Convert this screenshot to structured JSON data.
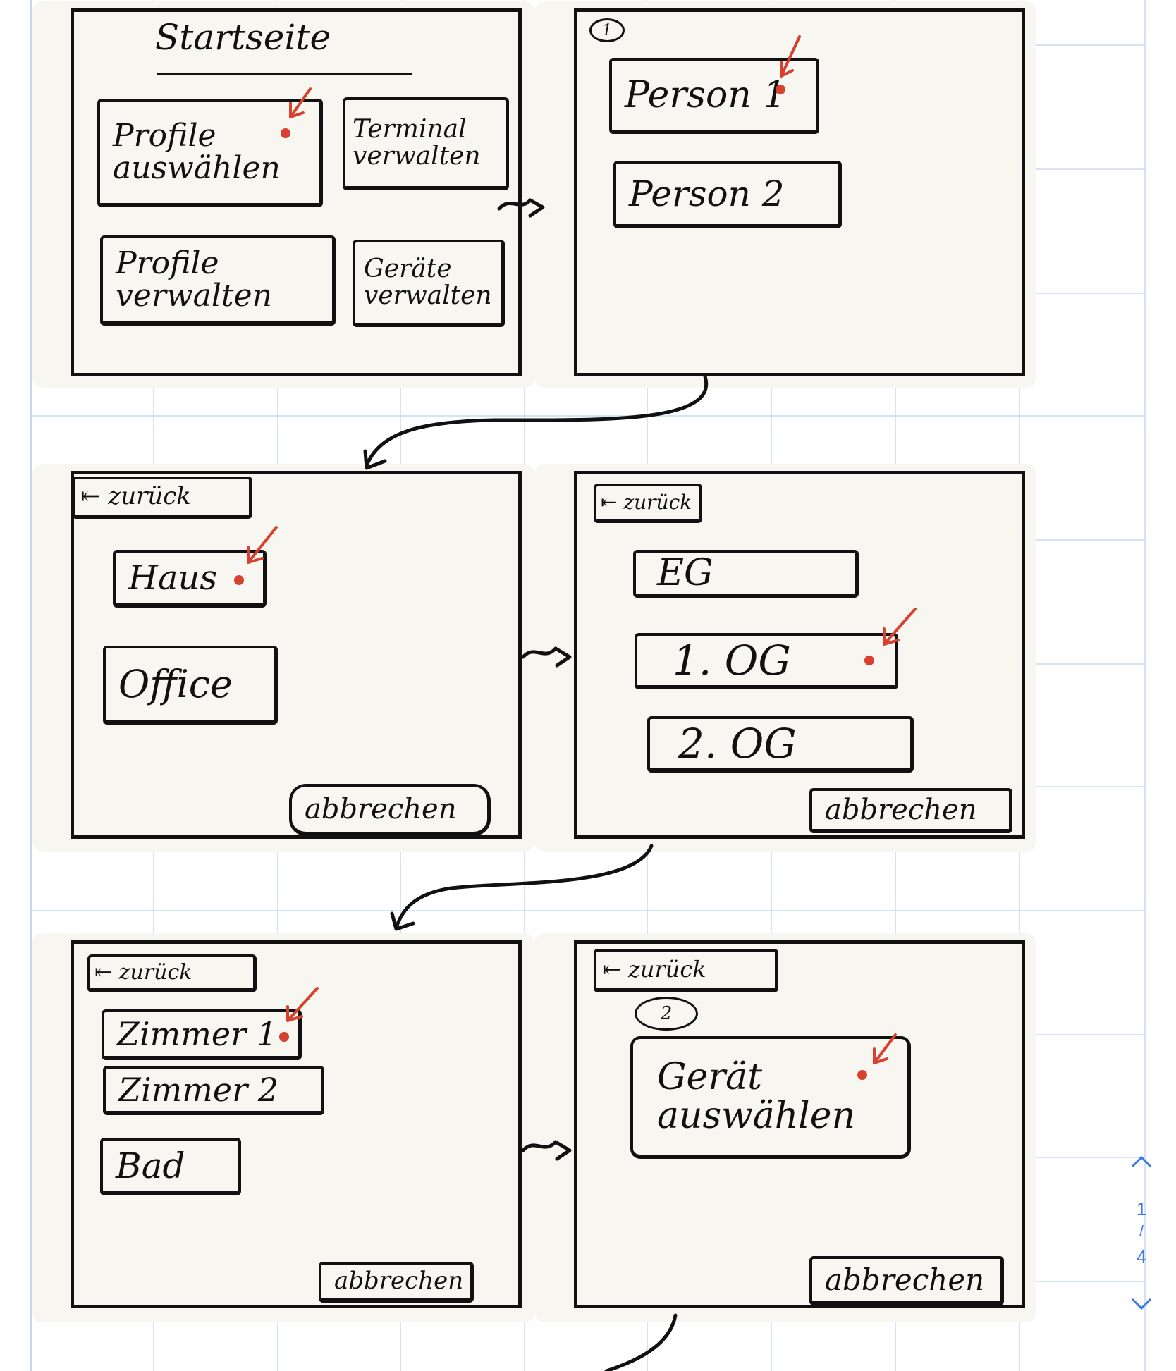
{
  "screens": {
    "start": {
      "title": "Startseite",
      "buttons": {
        "profile_select": [
          "Profile",
          "auswählen"
        ],
        "terminal_manage": [
          "Terminal",
          "verwalten"
        ],
        "profile_manage": [
          "Profile",
          "verwalten"
        ],
        "devices_manage": [
          "Geräte",
          "verwalten"
        ]
      }
    },
    "persons": {
      "step_label": "1",
      "items": [
        "Person 1",
        "Person 2"
      ]
    },
    "locations": {
      "back": "⇤ zurück",
      "items": [
        "Haus",
        "Office"
      ],
      "cancel": "abbrechen"
    },
    "floors": {
      "back": "⇤ zurück",
      "items": [
        "EG",
        "1. OG",
        "2. OG"
      ],
      "cancel": "abbrechen"
    },
    "rooms": {
      "back": "⇤ zurück",
      "items": [
        "Zimmer 1",
        "Zimmer 2",
        "Bad"
      ],
      "cancel": "abbrechen"
    },
    "device": {
      "back": "⇤ zurück",
      "step_label": "2",
      "select": [
        "Gerät",
        "auswählen"
      ],
      "cancel": "abbrechen"
    }
  },
  "pager": {
    "up_icon": "chevron-up-icon",
    "current": "1",
    "separator": "/",
    "total": "4",
    "down_icon": "chevron-down-icon"
  },
  "colors": {
    "ink": "#111111",
    "marker": "#d8412f",
    "grid": "#c9d8f5",
    "paper": "#f7f6f1",
    "accent": "#3b78e7"
  }
}
